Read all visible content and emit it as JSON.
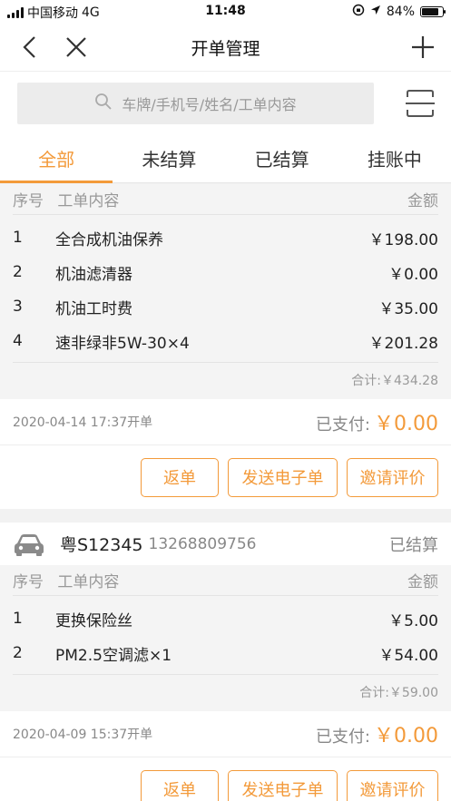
{
  "status_bar": {
    "carrier": "中国移动",
    "network": "4G",
    "time": "11:48",
    "battery": "84%",
    "battery_level": 0.84
  },
  "nav": {
    "title": "开单管理"
  },
  "search": {
    "placeholder": "车牌/手机号/姓名/工单内容"
  },
  "tabs": [
    {
      "label": "全部",
      "active": true
    },
    {
      "label": "未结算",
      "active": false
    },
    {
      "label": "已结算",
      "active": false
    },
    {
      "label": "挂账中",
      "active": false
    }
  ],
  "orders": [
    {
      "columns": {
        "no": "序号",
        "content": "工单内容",
        "amount": "金额"
      },
      "items": [
        {
          "no": "1",
          "name": "全合成机油保养",
          "price": "￥198.00"
        },
        {
          "no": "2",
          "name": "机油滤清器",
          "price": "￥0.00"
        },
        {
          "no": "3",
          "name": "机油工时费",
          "price": "￥35.00"
        },
        {
          "no": "4",
          "name": "速非绿非5W-30×4",
          "price": "￥201.28"
        }
      ],
      "subtotal": "合计:￥434.28",
      "date": "2020-04-14 17:37开单",
      "paid_label": "已支付:",
      "paid_amount": "￥0.00",
      "actions": [
        "返单",
        "发送电子单",
        "邀请评价"
      ]
    },
    {
      "plate": "粤S12345",
      "phone": "13268809756",
      "status": "已结算",
      "columns": {
        "no": "序号",
        "content": "工单内容",
        "amount": "金额"
      },
      "items": [
        {
          "no": "1",
          "name": "更换保险丝",
          "price": "￥5.00"
        },
        {
          "no": "2",
          "name": "PM2.5空调滤×1",
          "price": "￥54.00"
        }
      ],
      "subtotal": "合计:￥59.00",
      "date": "2020-04-09 15:37开单",
      "paid_label": "已支付:",
      "paid_amount": "￥0.00",
      "actions": [
        "返单",
        "发送电子单",
        "邀请评价"
      ]
    }
  ],
  "colors": {
    "accent": "#f39a3a",
    "muted": "#999999",
    "background": "#f2f2f2"
  },
  "icons": [
    "back-icon",
    "close-icon",
    "plus-icon",
    "search-icon",
    "scan-icon",
    "car-icon",
    "signal-icon",
    "location-icon",
    "battery-icon"
  ]
}
